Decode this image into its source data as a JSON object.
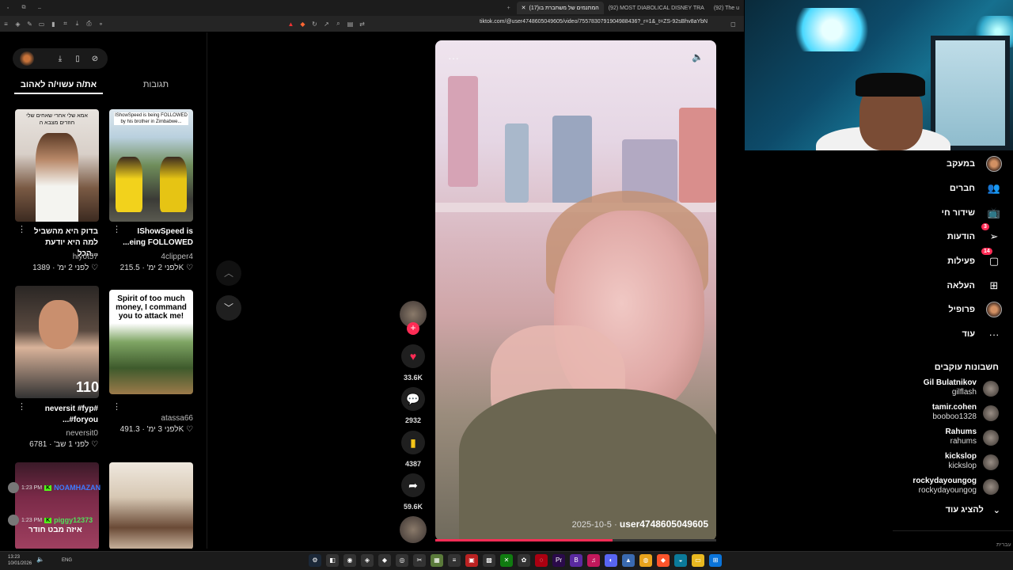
{
  "browser": {
    "tabs": [
      {
        "label": "(17)המתנמים של משחברת בו",
        "active": true
      },
      {
        "label": "(92) MOST DIABOLICAL DISNEY TRA",
        "active": false
      },
      {
        "label": "(92) The u",
        "active": false
      }
    ],
    "url": "tiktok.com/@user4748605049605/video/7557830791904988436?_r=1&_t=ZS-92sBhv8aYbN"
  },
  "left_panel": {
    "tabs": {
      "active": "את/ה עשוי/ה לאהוב",
      "inactive": "תגובות"
    },
    "cards": [
      {
        "caption": "בדוק היא מהשביל למה היא יודעת הכל...",
        "author": "hiyot57",
        "likes": "1389",
        "date": "לפני 2 ימ'",
        "overlay": "אמא שלי אחרי שאחים שלי חוזרים מצבא ה"
      },
      {
        "caption": "IShowSpeed is ...eing FOLLOWED",
        "author": "4clipper4",
        "likes": "215.5K",
        "date": "לפני 2 ימ'",
        "overlay": "IShowSpeed is being FOLLOWED by his brother in Zimbabwe..."
      },
      {
        "caption": "neversit #fyp# ...#foryou",
        "author": "neversit0",
        "likes": "6781",
        "date": "לפני 1 שב'",
        "overlay": "110"
      },
      {
        "caption": "",
        "author": "atassa66",
        "likes": "491.3K",
        "date": "לפני 3 ימ'",
        "overlay": "Spirit of too much money, I command you to attack me!"
      }
    ]
  },
  "chat": [
    {
      "time": "1:23 PM",
      "user": "NOAMHAZAN",
      "color": "#3d7bff"
    },
    {
      "time": "1:23 PM",
      "user": "piggy12373",
      "color": "#50e05a",
      "message": "איזה מבט חודר"
    }
  ],
  "video": {
    "date": "2025-10-5",
    "username": "user4748605049605",
    "progress": 0.63,
    "likes": "33.6K",
    "comments": "2932",
    "saves": "4387",
    "shares": "59.6K"
  },
  "right_nav": {
    "items": [
      {
        "label": "במעקב",
        "icon": "following-avatar-icon"
      },
      {
        "label": "חברים",
        "icon": "friends-icon"
      },
      {
        "label": "שידור חי",
        "icon": "live-icon"
      },
      {
        "label": "הודעות",
        "icon": "messages-icon",
        "badge": "3"
      },
      {
        "label": "פעילות",
        "icon": "activity-icon",
        "badge": "14"
      },
      {
        "label": "העלאה",
        "icon": "upload-icon"
      },
      {
        "label": "פרופיל",
        "icon": "profile-avatar-icon"
      },
      {
        "label": "עוד",
        "icon": "more-icon"
      }
    ],
    "following_title": "חשבונות עוקבים",
    "following": [
      {
        "name": "Gil Bulatnikov",
        "handle": "gilflash"
      },
      {
        "name": "tamir.cohen",
        "handle": "booboo1328"
      },
      {
        "name": "Rahums",
        "handle": "rahums"
      },
      {
        "name": "kickslop",
        "handle": "kickslop"
      },
      {
        "name": "rockydayoungog",
        "handle": "rockydayoungog"
      }
    ],
    "show_more": "להציג עוד",
    "corner_text": "עברית"
  },
  "taskbar": {
    "time": "13:23",
    "date": "10/01/2026",
    "lang": "ENG"
  },
  "colors": {
    "accent": "#fe2c55",
    "kick_green": "#53fc18"
  }
}
